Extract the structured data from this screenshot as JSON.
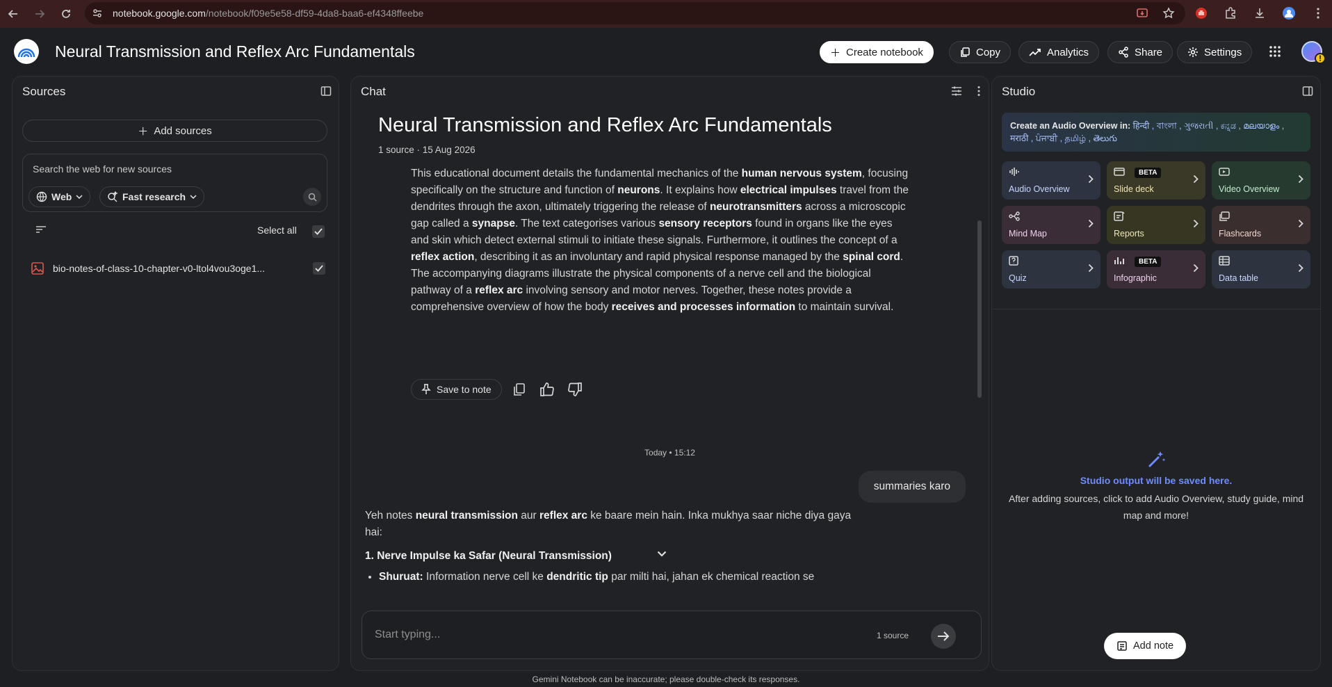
{
  "browser": {
    "url_host": "notebook.google.com",
    "url_path": "/notebook/f09e5e58-df59-4da8-baa6-ef4348ffeebe"
  },
  "header": {
    "title": "Neural Transmission and Reflex Arc Fundamentals",
    "create_label": "Create notebook",
    "copy_label": "Copy",
    "analytics_label": "Analytics",
    "share_label": "Share",
    "settings_label": "Settings",
    "avatar_warning": "!"
  },
  "sources": {
    "title": "Sources",
    "add_label": "Add sources",
    "search_placeholder": "Search the web for new sources",
    "web_chip": "Web",
    "research_chip": "Fast research",
    "select_all": "Select all",
    "items": [
      {
        "name": "bio-notes-of-class-10-chapter-v0-ltol4vou3oge1...",
        "checked": true
      }
    ]
  },
  "chat": {
    "title": "Chat",
    "notebook_title": "Neural Transmission and Reflex Arc Fundamentals",
    "meta": "1 source · 15 Aug 2026",
    "summary": [
      {
        "t": "This educational document details the fundamental mechanics of the "
      },
      {
        "b": "human nervous system"
      },
      {
        "t": ", focusing specifically on the structure and function of "
      },
      {
        "b": "neurons"
      },
      {
        "t": ". It explains how "
      },
      {
        "b": "electrical impulses"
      },
      {
        "t": " travel from the dendrites through the axon, ultimately triggering the release of "
      },
      {
        "b": "neurotransmitters"
      },
      {
        "t": " across a microscopic gap called a "
      },
      {
        "b": "synapse"
      },
      {
        "t": ". The text categorises various "
      },
      {
        "b": "sensory receptors"
      },
      {
        "t": " found in organs like the eyes and skin which detect external stimuli to initiate these signals. Furthermore, it outlines the concept of a "
      },
      {
        "b": "reflex action"
      },
      {
        "t": ", describing it as an involuntary and rapid physical response managed by the "
      },
      {
        "b": "spinal cord"
      },
      {
        "t": ". The accompanying diagrams illustrate the physical components of a nerve cell and the biological pathway of a "
      },
      {
        "b": "reflex arc"
      },
      {
        "t": " involving sensory and motor nerves. Together, these notes provide a comprehensive overview of how the body "
      },
      {
        "b": "receives and processes information"
      },
      {
        "t": " to maintain survival."
      }
    ],
    "save_note_label": "Save to note",
    "timestamp": "Today • 15:12",
    "user_message": "summaries karo",
    "answer_intro": [
      {
        "t": "Yeh notes "
      },
      {
        "b": "neural transmission"
      },
      {
        "t": " aur "
      },
      {
        "b": "reflex arc"
      },
      {
        "t": " ke baare mein hain. Inka mukhya saar niche diya gaya hai:"
      }
    ],
    "answer_heading": "1. Nerve Impulse ka Safar (Neural Transmission)",
    "answer_bullet": [
      {
        "b": "Shuruat:"
      },
      {
        "t": " Information nerve cell ke "
      },
      {
        "b": "dendritic tip"
      },
      {
        "t": " par milti hai, jahan ek chemical reaction se"
      }
    ],
    "input_placeholder": "Start typing...",
    "source_count": "1 source"
  },
  "studio": {
    "title": "Studio",
    "banner_prefix": "Create an Audio Overview in: ",
    "banner_langs": "हिन्दी , বাংলা , ગુજરાતી , ಕನ್ನಡ , മലയാളം , मराठी , ਪੰਜਾਬੀ , தமிழ் , తెలుగు",
    "tiles": [
      {
        "label": "Audio Overview",
        "icon": "audio-icon",
        "bg": "#2d3340",
        "fg": "#c8d7ff",
        "beta": ""
      },
      {
        "label": "Slide deck",
        "icon": "slides-icon",
        "bg": "#3a3826",
        "fg": "#f1e6b0",
        "beta": "BETA"
      },
      {
        "label": "Video Overview",
        "icon": "video-icon",
        "bg": "#263a2f",
        "fg": "#c5ecd2",
        "beta": ""
      },
      {
        "label": "Mind Map",
        "icon": "mindmap-icon",
        "bg": "#3a2d38",
        "fg": "#f1d2ec",
        "beta": ""
      },
      {
        "label": "Reports",
        "icon": "reports-icon",
        "bg": "#363622",
        "fg": "#eee8b6",
        "beta": ""
      },
      {
        "label": "Flashcards",
        "icon": "flashcards-icon",
        "bg": "#3a2e2e",
        "fg": "#f1d6d0",
        "beta": ""
      },
      {
        "label": "Quiz",
        "icon": "quiz-icon",
        "bg": "#2d3440",
        "fg": "#c8daff",
        "beta": ""
      },
      {
        "label": "Infographic",
        "icon": "infographic-icon",
        "bg": "#3a2d38",
        "fg": "#f1d2ec",
        "beta": "BETA"
      },
      {
        "label": "Data table",
        "icon": "table-icon",
        "bg": "#2d3440",
        "fg": "#c8daff",
        "beta": ""
      }
    ],
    "empty_title": "Studio output will be saved here.",
    "empty_desc": "After adding sources, click to add Audio Overview, study guide, mind map and more!",
    "add_note_label": "Add note"
  },
  "footer": "Gemini Notebook can be inaccurate; please double-check its responses."
}
